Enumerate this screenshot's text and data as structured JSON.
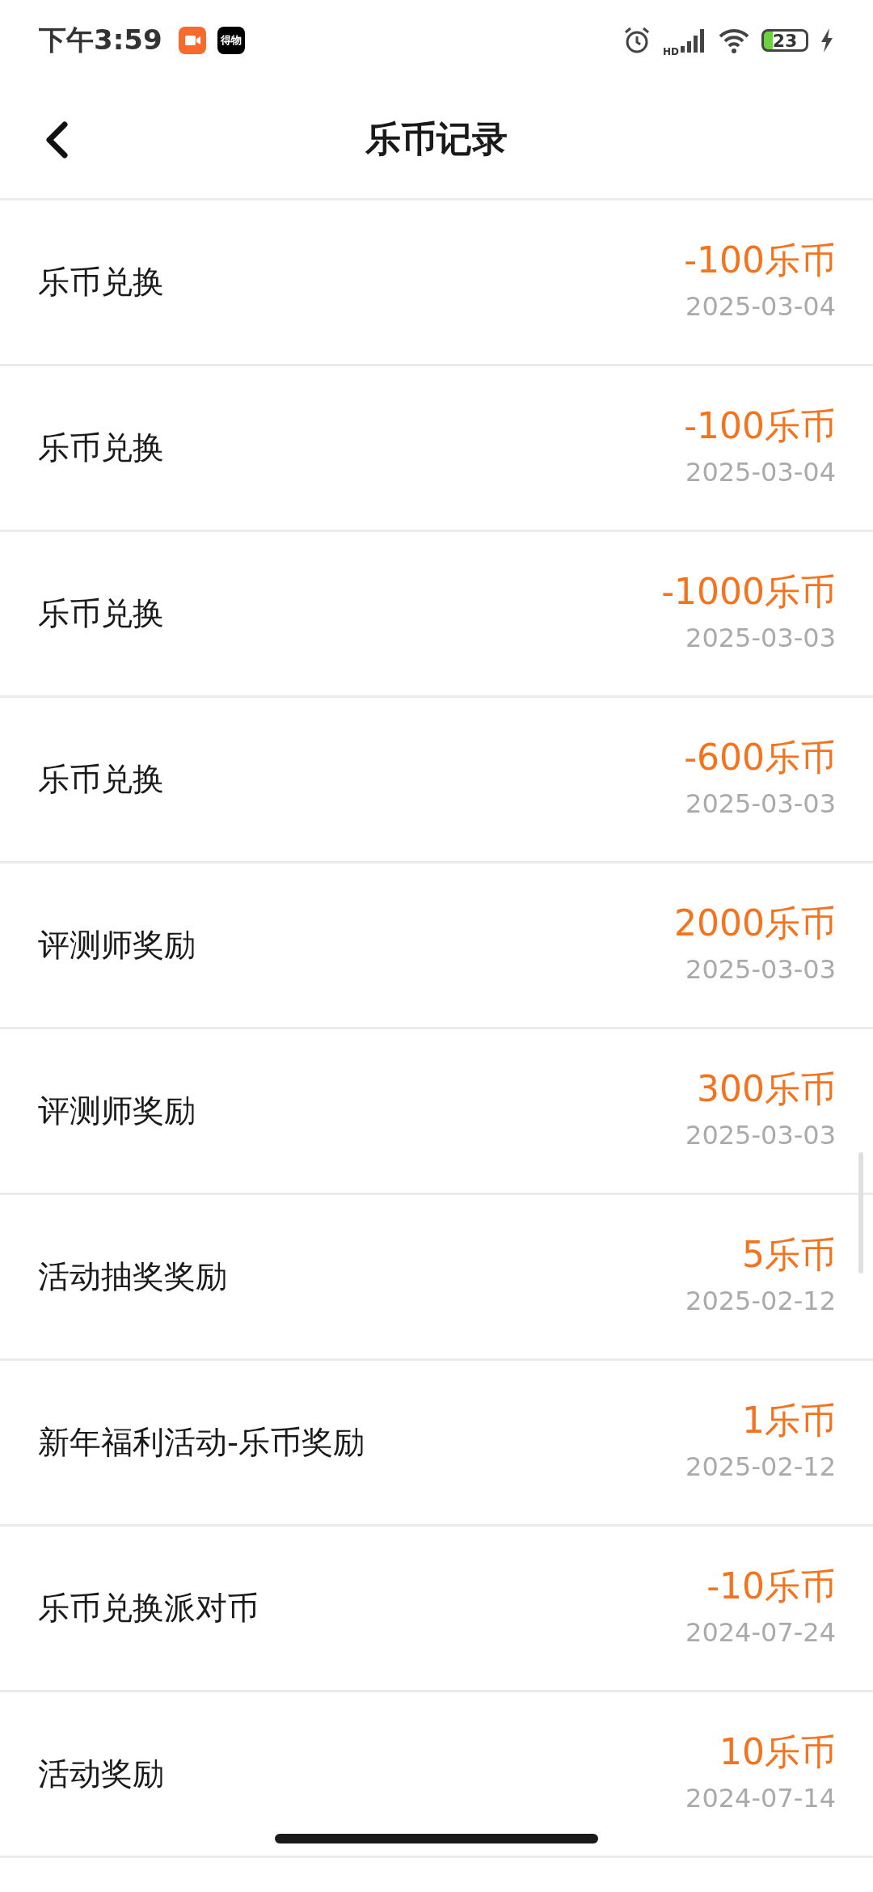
{
  "status_bar": {
    "time": "下午3:59",
    "app_badge": "得物",
    "network": "HD",
    "battery": "23"
  },
  "header": {
    "title": "乐币记录"
  },
  "records": [
    {
      "title": "乐币兑换",
      "amount": "-100乐币",
      "date": "2025-03-04"
    },
    {
      "title": "乐币兑换",
      "amount": "-100乐币",
      "date": "2025-03-04"
    },
    {
      "title": "乐币兑换",
      "amount": "-1000乐币",
      "date": "2025-03-03"
    },
    {
      "title": "乐币兑换",
      "amount": "-600乐币",
      "date": "2025-03-03"
    },
    {
      "title": "评测师奖励",
      "amount": "2000乐币",
      "date": "2025-03-03"
    },
    {
      "title": "评测师奖励",
      "amount": "300乐币",
      "date": "2025-03-03"
    },
    {
      "title": "活动抽奖奖励",
      "amount": "5乐币",
      "date": "2025-02-12"
    },
    {
      "title": "新年福利活动-乐币奖励",
      "amount": "1乐币",
      "date": "2025-02-12"
    },
    {
      "title": "乐币兑换派对币",
      "amount": "-10乐币",
      "date": "2024-07-24"
    },
    {
      "title": "活动奖励",
      "amount": "10乐币",
      "date": "2024-07-14"
    }
  ]
}
